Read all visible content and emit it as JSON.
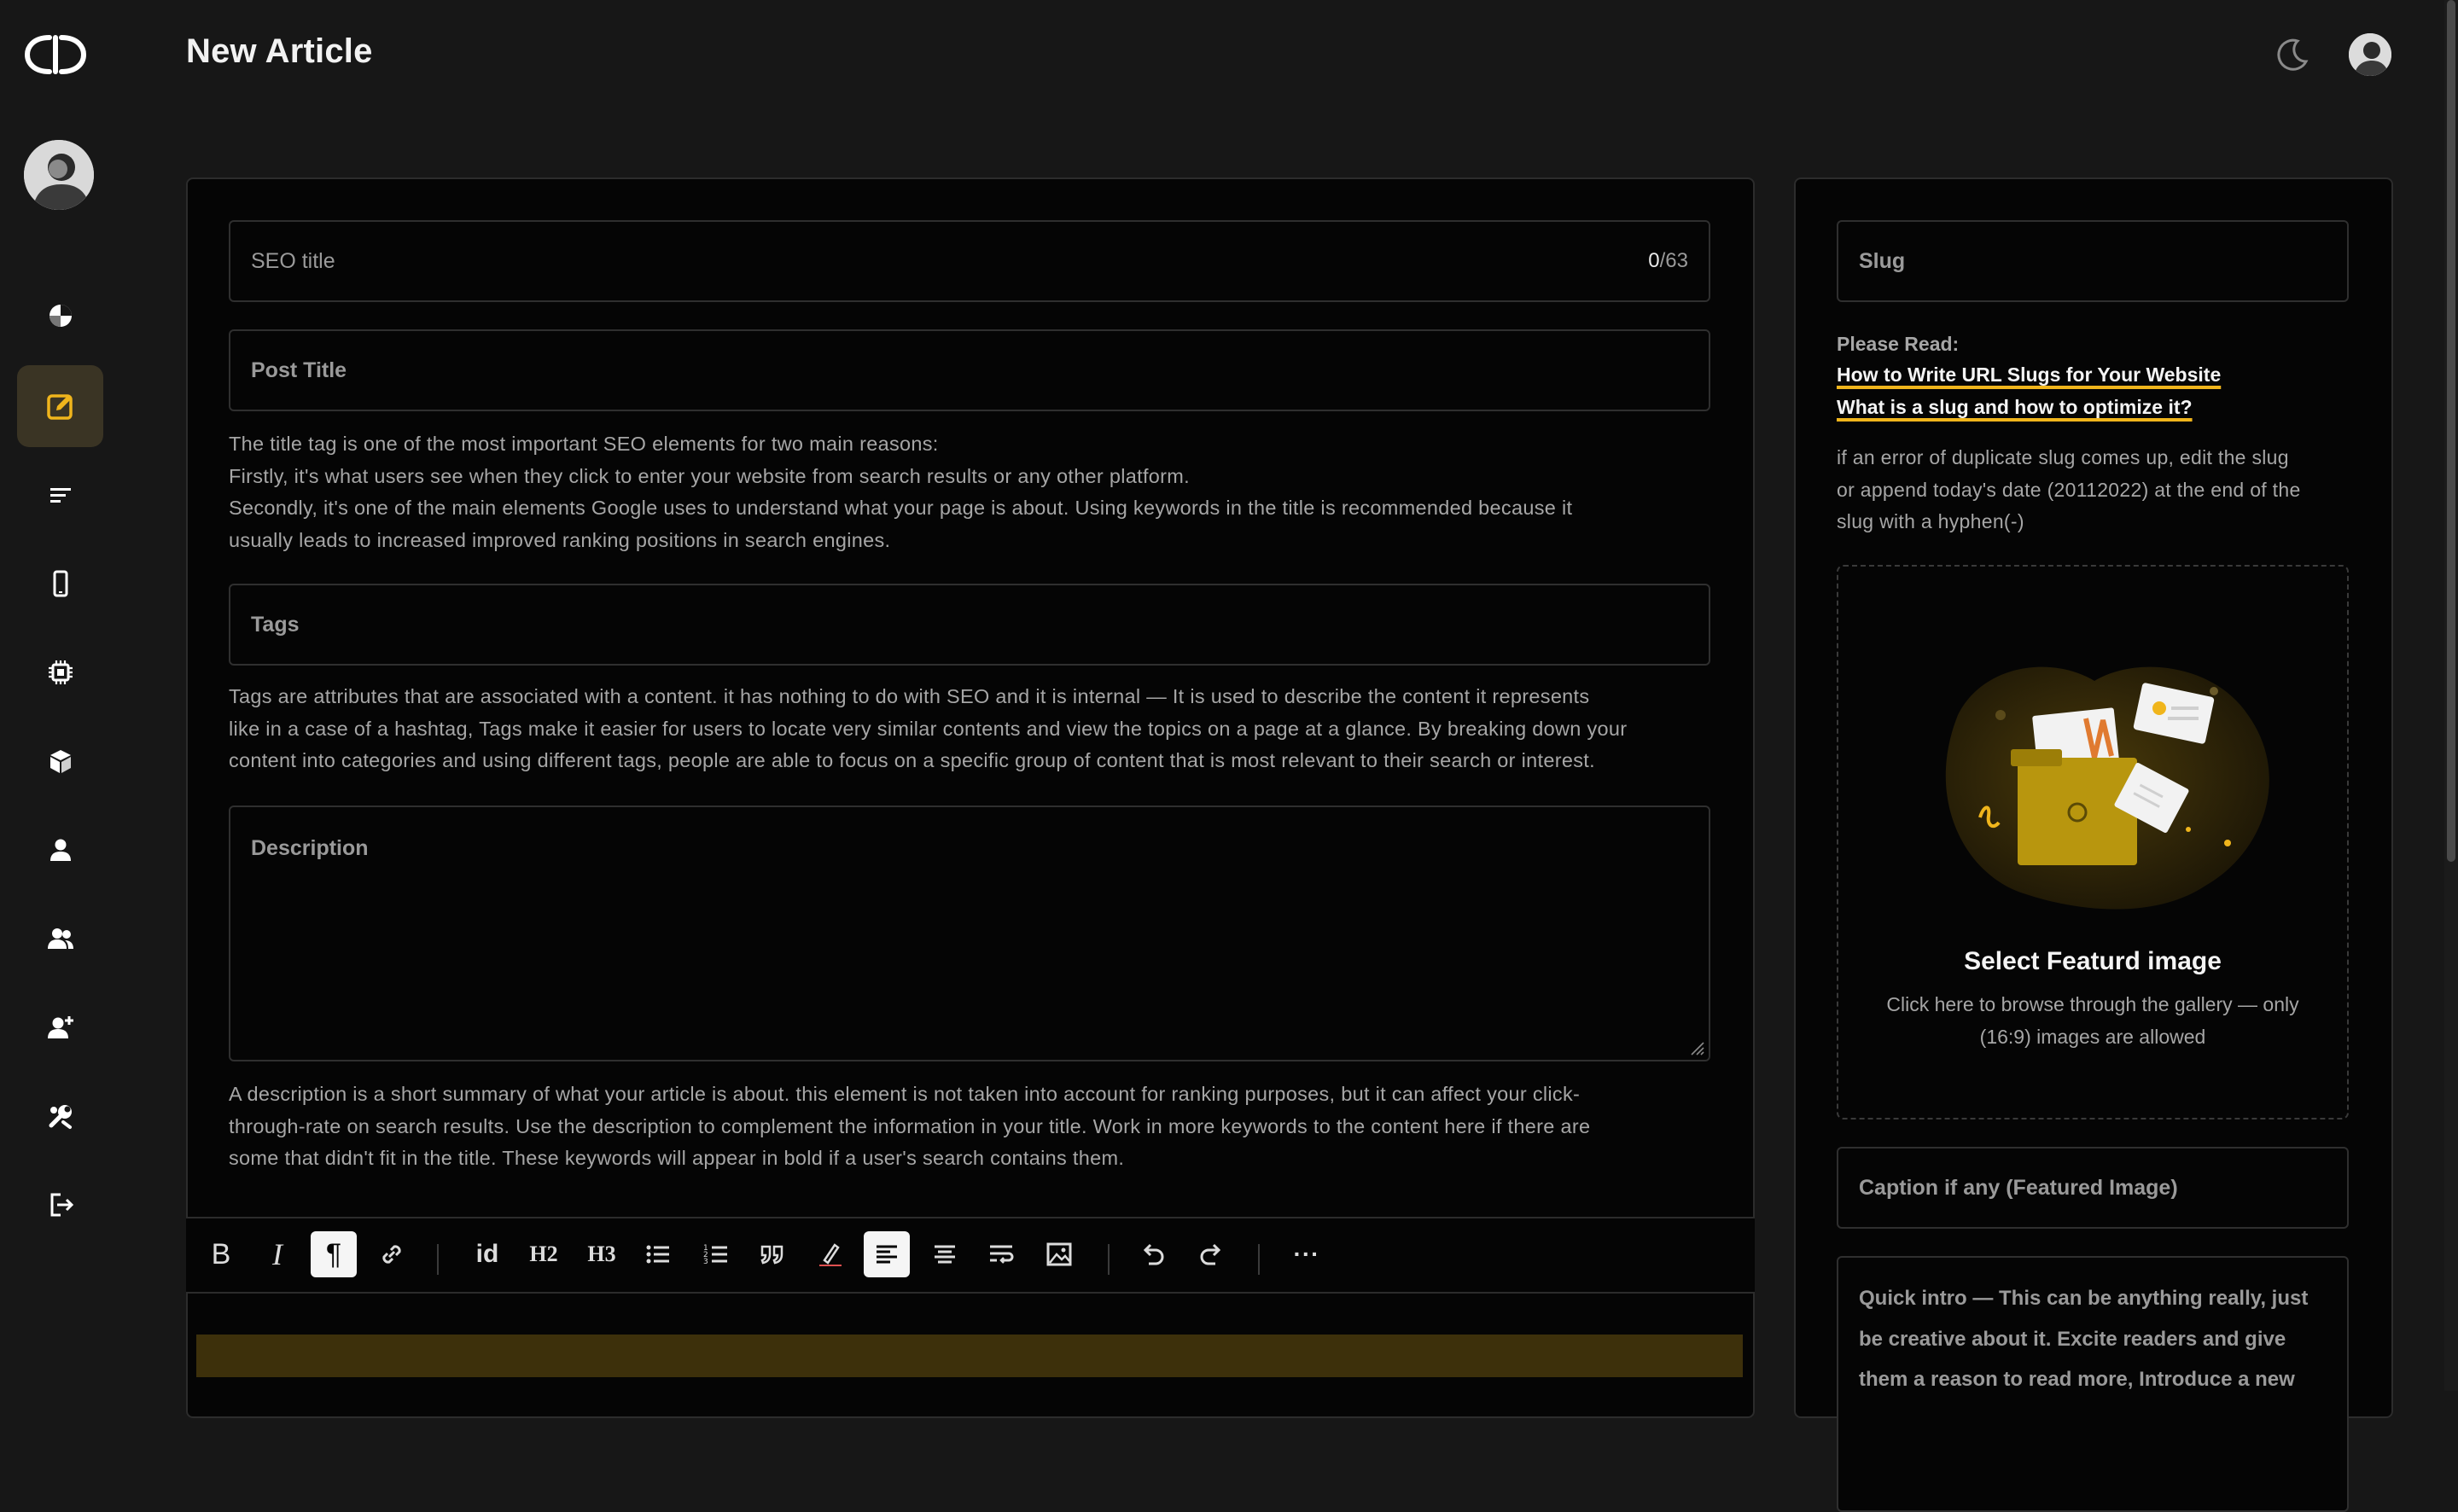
{
  "header": {
    "title": "New Article"
  },
  "sidebar": {
    "items": [
      {
        "name": "dashboard",
        "icon": "pie-chart-icon",
        "active": false
      },
      {
        "name": "new-article",
        "icon": "edit-icon",
        "active": true
      },
      {
        "name": "articles",
        "icon": "list-icon",
        "active": false
      },
      {
        "name": "mobile",
        "icon": "phone-icon",
        "active": false
      },
      {
        "name": "chip",
        "icon": "chip-icon",
        "active": false
      },
      {
        "name": "packages",
        "icon": "cube-icon",
        "active": false
      },
      {
        "name": "profile",
        "icon": "user-icon",
        "active": false
      },
      {
        "name": "team",
        "icon": "users-icon",
        "active": false
      },
      {
        "name": "add-user",
        "icon": "user-plus-icon",
        "active": false
      },
      {
        "name": "moderation",
        "icon": "tool-icon",
        "active": false
      },
      {
        "name": "logout",
        "icon": "logout-icon",
        "active": false
      }
    ]
  },
  "main": {
    "seo_title": {
      "placeholder": "SEO title",
      "count": "0",
      "max": "/63"
    },
    "post_title": {
      "placeholder": "Post Title"
    },
    "title_help": [
      "The title tag is one of the most important SEO elements for two main reasons:",
      "Firstly, it's what users see when they click to enter your website from search results or any other platform.",
      "Secondly, it's one of the main elements Google uses to understand what your page is about. Using keywords in the title is recommended because it",
      "usually leads to increased improved ranking positions in search engines."
    ],
    "tags": {
      "placeholder": "Tags"
    },
    "tags_help": [
      "Tags are attributes that are associated with a content. it has nothing to do with SEO and it is internal — It is used to describe the content it represents",
      "like in a case of a hashtag, Tags make it easier for users to locate very similar contents and view the topics on a page at a glance. By breaking down your",
      "content into categories and using different tags, people are able to focus on a specific group of content that is most relevant to their search or interest."
    ],
    "description": {
      "placeholder": "Description"
    },
    "description_help": [
      "A description is a short summary of what your article is about. this element is not taken into account for ranking purposes, but it can affect your click-",
      "through-rate on search results. Use the description to complement the information in your title. Work in more keywords to the content here if there are",
      "some that didn't fit in the title. These keywords will appear in bold if a user's search contains them."
    ],
    "toolbar": {
      "bold": "B",
      "italic": "I",
      "paragraph": "¶",
      "id": "id",
      "h2": "H2",
      "h3": "H3",
      "more": "···"
    }
  },
  "side": {
    "slug": {
      "placeholder": "Slug"
    },
    "please_read": "Please Read:",
    "links": [
      "How to Write URL Slugs for Your Website",
      "What is a slug and how to optimize it?"
    ],
    "slug_help": [
      "if an error of duplicate slug comes up, edit the slug",
      "or append today's date (20112022) at the end of the",
      "slug with a hyphen(-)"
    ],
    "featured_image": {
      "title": "Select Featurd image",
      "subtitle_1": "Click here to browse through the gallery — only",
      "subtitle_2": "(16:9) images are allowed"
    },
    "caption": {
      "placeholder": "Caption if any (Featured Image)"
    },
    "intro": {
      "text": "Quick intro — This can be anything really, just be creative about it. Excite readers and give them a reason to read more, Introduce a new"
    }
  },
  "colors": {
    "accent": "#f0b51c",
    "active_nav_bg": "#3a3424",
    "panel_bg": "#050505",
    "page_bg": "#171717"
  }
}
